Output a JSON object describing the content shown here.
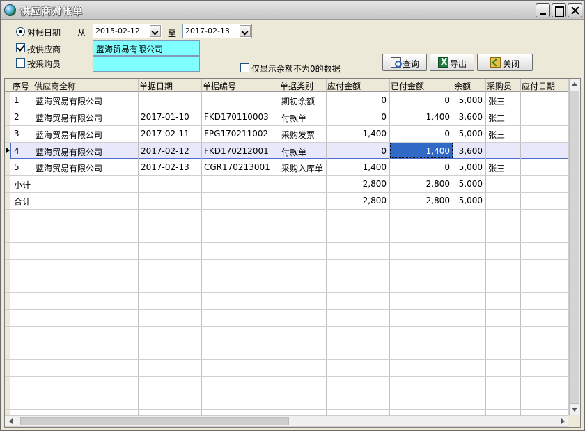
{
  "window": {
    "title": "供应商对帐单"
  },
  "filters": {
    "date_label": "对帐日期",
    "from_label": "从",
    "from_date": "2015-02-12",
    "to_label": "至",
    "to_date": "2017-02-13",
    "by_supplier_label": "按供应商",
    "supplier_value": "蓝海贸易有限公司",
    "by_buyer_label": "按采购员",
    "buyer_value": "",
    "nonzero_label": "仅显示余额不为0的数据"
  },
  "buttons": {
    "query": "查询",
    "export": "导出",
    "close": "关闭"
  },
  "columns": [
    "序号",
    "供应商全称",
    "单据日期",
    "单据编号",
    "单据类别",
    "应付金额",
    "已付金额",
    "余额",
    "采购员",
    "应付日期"
  ],
  "rows": [
    {
      "no": "1",
      "supplier": "蓝海贸易有限公司",
      "date": "",
      "code": "",
      "type": "期初余额",
      "payable": "0",
      "paid": "0",
      "balance": "5,000",
      "buyer": "张三",
      "due": ""
    },
    {
      "no": "2",
      "supplier": "蓝海贸易有限公司",
      "date": "2017-01-10",
      "code": "FKD170110003",
      "type": "付款单",
      "payable": "0",
      "paid": "1,400",
      "balance": "3,600",
      "buyer": "张三",
      "due": ""
    },
    {
      "no": "3",
      "supplier": "蓝海贸易有限公司",
      "date": "2017-02-11",
      "code": "FPG170211002",
      "type": "采购发票",
      "payable": "1,400",
      "paid": "0",
      "balance": "5,000",
      "buyer": "张三",
      "due": ""
    },
    {
      "no": "4",
      "supplier": "蓝海贸易有限公司",
      "date": "2017-02-12",
      "code": "FKD170212001",
      "type": "付款单",
      "payable": "0",
      "paid": "1,400",
      "balance": "3,600",
      "buyer": "",
      "due": ""
    },
    {
      "no": "5",
      "supplier": "蓝海贸易有限公司",
      "date": "2017-02-13",
      "code": "CGR170213001",
      "type": "采购入库单",
      "payable": "1,400",
      "paid": "0",
      "balance": "5,000",
      "buyer": "张三",
      "due": ""
    },
    {
      "no": "小计",
      "supplier": "",
      "date": "",
      "code": "",
      "type": "",
      "payable": "2,800",
      "paid": "2,800",
      "balance": "5,000",
      "buyer": "",
      "due": ""
    },
    {
      "no": "合计",
      "supplier": "",
      "date": "",
      "code": "",
      "type": "",
      "payable": "2,800",
      "paid": "2,800",
      "balance": "5,000",
      "buyer": "",
      "due": ""
    }
  ],
  "selected_row": 3
}
